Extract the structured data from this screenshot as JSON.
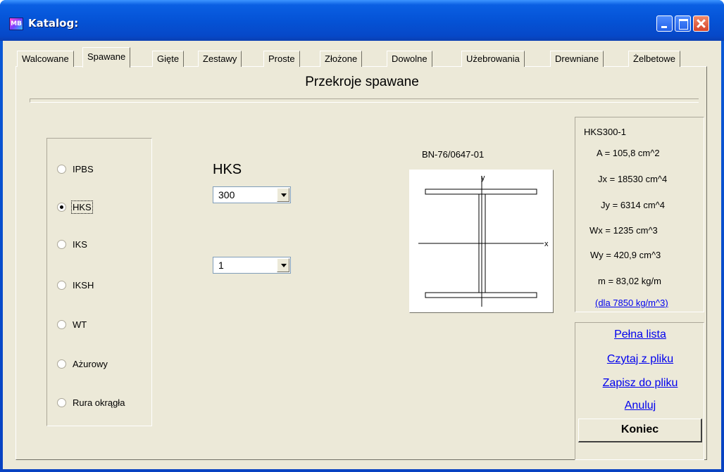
{
  "window": {
    "title": "Katalog:",
    "icon_label": "MB"
  },
  "tabs": [
    {
      "label": "Walcowane",
      "active": false
    },
    {
      "label": "Spawane",
      "active": true
    },
    {
      "label": "Gięte",
      "active": false
    },
    {
      "label": "Zestawy",
      "active": false
    },
    {
      "label": "Proste",
      "active": false
    },
    {
      "label": "Złożone",
      "active": false
    },
    {
      "label": "Dowolne",
      "active": false
    },
    {
      "label": "Użebrowania",
      "active": false
    },
    {
      "label": "Drewniane",
      "active": false
    },
    {
      "label": "Żelbetowe",
      "active": false
    }
  ],
  "section_title": "Przekroje spawane",
  "profile_types": [
    {
      "label": "IPBS",
      "checked": false
    },
    {
      "label": "HKS",
      "checked": true
    },
    {
      "label": "IKS",
      "checked": false
    },
    {
      "label": "IKSH",
      "checked": false
    },
    {
      "label": "WT",
      "checked": false
    },
    {
      "label": "Ażurowy",
      "checked": false
    },
    {
      "label": "Rura okrągła",
      "checked": false
    }
  ],
  "profile_heading": "HKS",
  "size_select": {
    "value": "300"
  },
  "variant_select": {
    "value": "1"
  },
  "norm": "BN-76/0647-01",
  "drawing": {
    "axis_x": "x",
    "axis_y": "y"
  },
  "properties": {
    "name": "HKS300-1",
    "A": "A = 105,8 cm^2",
    "Jx": "Jx = 18530 cm^4",
    "Jy": "Jy = 6314 cm^4",
    "Wx": "Wx = 1235 cm^3",
    "Wy": "Wy = 420,9 cm^3",
    "m": "m = 83,02 kg/m",
    "density_link": "(dla 7850 kg/m^3)"
  },
  "actions": {
    "full_list": "Pełna lista",
    "read_file": "Czytaj z pliku",
    "save_file": "Zapisz do pliku",
    "cancel": "Anuluj",
    "end": "Koniec"
  },
  "colors": {
    "titlebar": "#0553d6",
    "client_bg": "#ece9d8",
    "link": "#0000ee"
  }
}
